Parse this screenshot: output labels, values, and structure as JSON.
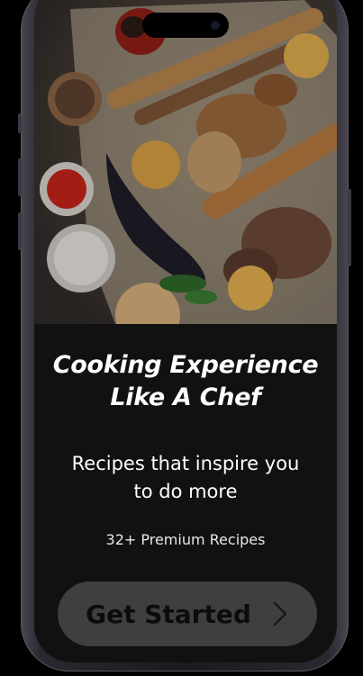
{
  "onboarding": {
    "title_line1": "Cooking Experience",
    "title_line2": "Like A Chef",
    "subtitle_line1": "Recipes that inspire you",
    "subtitle_line2": "to do more",
    "recipe_count": "32+ Premium Recipes",
    "cta_label": "Get Started",
    "cta_icon": "chevron-right-icon"
  },
  "colors": {
    "background": "#000000",
    "screen": "#111111",
    "button": "#3f3f3f",
    "button_text": "#0c0c0c",
    "text": "#ffffff"
  }
}
